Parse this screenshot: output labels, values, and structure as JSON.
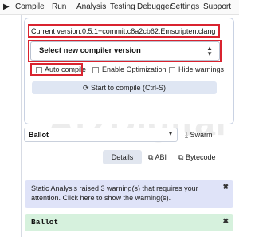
{
  "menu": {
    "arrow_icon": "play-triangle-icon",
    "items": [
      "Compile",
      "Run",
      "Analysis",
      "Testing",
      "Debugger",
      "Settings",
      "Support"
    ]
  },
  "compiler": {
    "current_version": "Current version:0.5.1+commit.c8a2cb62.Emscripten.clang",
    "select_label": "Select new compiler version",
    "auto_compile": "Auto compile",
    "enable_optimization": "Enable Optimization",
    "hide_warnings": "Hide warnings",
    "compile_button": "Start to compile (Ctrl-S)",
    "compile_icon": "refresh-icon"
  },
  "contract": {
    "selected": "Ballot",
    "swarm_label": "Swarm",
    "details_label": "Details",
    "abi_label": "ABI",
    "bytecode_label": "Bytecode"
  },
  "alerts": {
    "warning_text": "Static Analysis raised 3 warning(s) that requires your attention. Click here to show the warning(s).",
    "success_text": "Ballot"
  },
  "watermark": "ArzDigital",
  "colors": {
    "highlight_red": "#d9232f",
    "warning_bg": "#dfe3f8",
    "success_bg": "#d6f1dd",
    "button_bg": "#dfe6f3"
  }
}
